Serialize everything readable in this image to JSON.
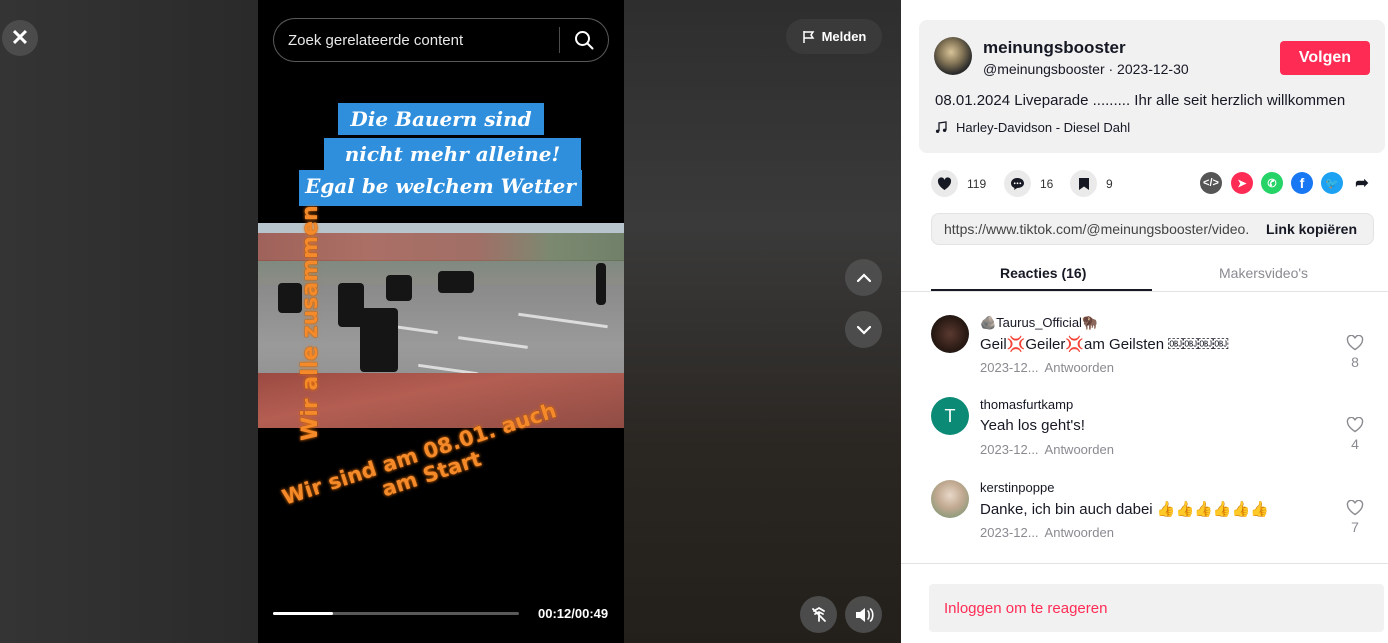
{
  "player": {
    "search_placeholder": "Zoek gerelateerde content",
    "report_label": "Melden",
    "time": "00:12/00:49",
    "progress": 0.245,
    "captions": [
      "Die Bauern sind",
      "nicht mehr alleine!",
      "Egal be welchem Wetter"
    ],
    "overlay_vertical": "Wir alle zusammen",
    "overlay_bottom_1": "Wir sind am 08.01. auch",
    "overlay_bottom_2": "am Start",
    "icons": [
      "close-icon",
      "search-icon",
      "flag-icon",
      "chevron-up-icon",
      "chevron-down-icon",
      "floating-player-icon",
      "volume-icon"
    ]
  },
  "author": {
    "display_name": "meinungsbooster",
    "handle_date": "@meinungsbooster · 2023-12-30",
    "follow_label": "Volgen",
    "description": "08.01.2024 Liveparade ......... Ihr alle seit herzlich willkommen",
    "music": "Harley-Davidson - Diesel Dahl"
  },
  "actions": {
    "likes": "119",
    "comments": "16",
    "saves": "9"
  },
  "share": {
    "url": "https://www.tiktok.com/@meinungsbooster/video...",
    "copy_label": "Link kopiëren",
    "colors": {
      "embed": "#555555",
      "send": "#fe2c55",
      "whatsapp": "#25d366",
      "facebook": "#1877f2",
      "twitter": "#1da1f2"
    }
  },
  "tabs": [
    {
      "label": "Reacties (16)",
      "active": true
    },
    {
      "label": "Makersvideo's",
      "active": false
    }
  ],
  "comments": [
    {
      "name": "🪨Taurus_Official🦬",
      "text": "Geil💢Geiler💢am Geilsten ￼￼￼￼",
      "date": "2023-12...",
      "reply": "Antwoorden",
      "likes": "8",
      "avatar_letter": ""
    },
    {
      "name": "thomasfurtkamp",
      "text": "Yeah los geht's!",
      "date": "2023-12...",
      "reply": "Antwoorden",
      "likes": "4",
      "avatar_letter": "T"
    },
    {
      "name": "kerstinpoppe",
      "text": "Danke, ich bin auch dabei 👍👍👍👍👍👍",
      "date": "2023-12...",
      "reply": "Antwoorden",
      "likes": "7",
      "avatar_letter": ""
    }
  ],
  "login_label": "Inloggen om te reageren"
}
